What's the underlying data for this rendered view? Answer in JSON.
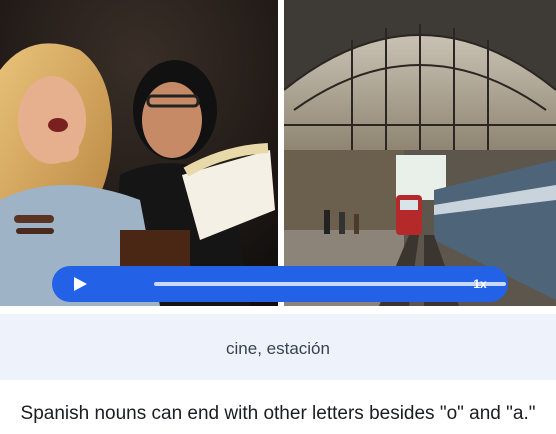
{
  "media": {
    "left_photo_icon": "people-eating-popcorn-photo",
    "right_photo_icon": "train-station-photo"
  },
  "player": {
    "play_icon": "play-icon",
    "progress": 0.0,
    "speed_label": "1x",
    "accent_color": "#2361e6"
  },
  "lesson": {
    "words": "cine, estación",
    "explanation": "Spanish nouns can end with other letters besides \"o\" and \"a.\""
  }
}
